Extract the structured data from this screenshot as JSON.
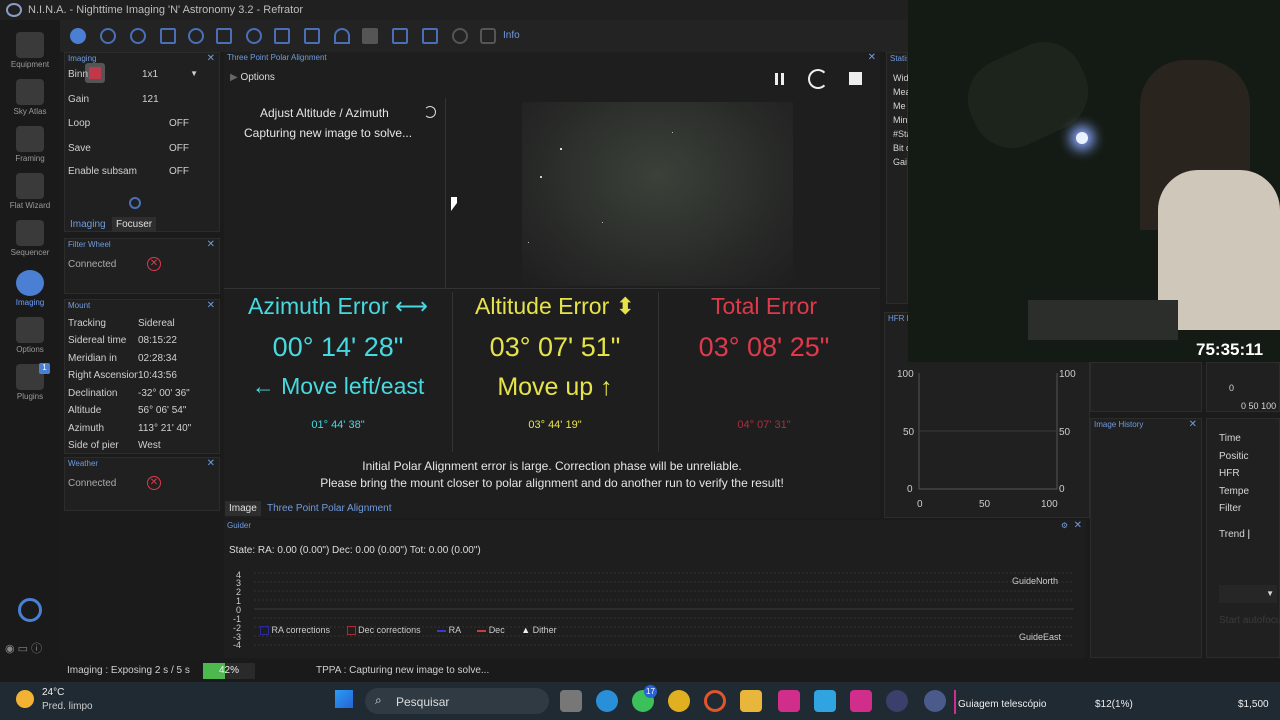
{
  "window": {
    "title": "N.I.N.A. - Nighttime Imaging 'N' Astronomy 3.2  -  Refrator"
  },
  "sidebar": {
    "items": [
      {
        "label": "Equipment",
        "icon": "camera-icon"
      },
      {
        "label": "Sky Atlas",
        "icon": "map-icon"
      },
      {
        "label": "Framing",
        "icon": "framing-icon"
      },
      {
        "label": "Flat Wizard",
        "icon": "flat-icon"
      },
      {
        "label": "Sequencer",
        "icon": "sequencer-icon"
      },
      {
        "label": "Imaging",
        "icon": "imaging-icon"
      },
      {
        "label": "Options",
        "icon": "gear-icon"
      },
      {
        "label": "Plugins",
        "icon": "puzzle-icon"
      }
    ],
    "plugins_badge": "1",
    "collapse": "< <"
  },
  "toolbar": {
    "info_label": "Info"
  },
  "imaging_panel": {
    "title": "Imaging",
    "rows": [
      {
        "label": "Binn",
        "value": "1x1"
      },
      {
        "label": "Gain",
        "value": "121"
      },
      {
        "label": "Loop",
        "value": "OFF"
      },
      {
        "label": "Save",
        "value": "OFF"
      },
      {
        "label": "Enable subsam",
        "value": "OFF"
      }
    ],
    "tabs": [
      "Imaging",
      "Focuser"
    ]
  },
  "filterwheel": {
    "title": "Filter Wheel",
    "connected": "Connected"
  },
  "mount": {
    "title": "Mount",
    "rows": [
      {
        "label": "Tracking",
        "value": "Sidereal"
      },
      {
        "label": "Sidereal time",
        "value": "08:15:22"
      },
      {
        "label": "Meridian in",
        "value": "02:28:34"
      },
      {
        "label": "Right Ascension",
        "value": "10:43:56"
      },
      {
        "label": "Declination",
        "value": "-32° 00' 36\""
      },
      {
        "label": "Altitude",
        "value": "56° 06' 54\""
      },
      {
        "label": "Azimuth",
        "value": "113° 21' 40\""
      },
      {
        "label": "Side of pier",
        "value": "West"
      }
    ]
  },
  "weather": {
    "title": "Weather",
    "connected": "Connected"
  },
  "tppa": {
    "title": "Three Point Polar Alignment",
    "options": "Options",
    "step": "Adjust Altitude / Azimuth",
    "status": "Capturing new image to solve...",
    "az_title": "Azimuth Error ⟷",
    "az_value": "00° 14' 28\"",
    "az_move": "← Move left/east",
    "az_sub": "01° 44' 38\"",
    "alt_title": "Altitude Error ⬍",
    "alt_value": "03° 07' 51\"",
    "alt_move": "Move up ↑",
    "alt_sub": "03° 44' 19\"",
    "tot_title": "Total Error",
    "tot_value": "03° 08' 25\"",
    "tot_sub": "04° 07' 31\"",
    "warning1": "Initial Polar Alignment error is large. Correction phase will be unreliable.",
    "warning2": "Please bring the mount closer to polar alignment and do another run to verify the result!",
    "tabs": [
      "Image",
      "Three Point Polar Alignment"
    ]
  },
  "statistics": {
    "title": "Statist",
    "rows": [
      "Wid",
      "Mea",
      "Me",
      "Min",
      "#Sta",
      "Bit d",
      "Gai"
    ]
  },
  "hfr": {
    "title": "HFR h",
    "yticks": [
      "100",
      "50",
      "0"
    ],
    "xticks": [
      "0",
      "50",
      "100"
    ],
    "bottom_labels": [
      "0",
      "50",
      "100"
    ]
  },
  "image_history": {
    "title": "Image History"
  },
  "right_info": {
    "rows": [
      "Time",
      "Positic",
      "HFR",
      "Tempe",
      "Filter",
      "Trend"
    ]
  },
  "right_misc": {
    "start_label": "Start autofocus"
  },
  "guider": {
    "title": "Guider",
    "state": "State:  RA: 0.00 (0.00\")  Dec: 0.00 (0.00\")  Tot: 0.00 (0.00\")",
    "yticks": [
      "4",
      "3",
      "2",
      "1",
      "0",
      "-1",
      "-2",
      "-3",
      "-4"
    ],
    "north": "GuideNorth",
    "east": "GuideEast",
    "legend": [
      "RA corrections",
      "Dec corrections",
      "RA",
      "Dec",
      "Dither"
    ]
  },
  "statusbar": {
    "imaging": "Imaging :   Exposing 2 s / 5 s",
    "progress": 0.42,
    "progress_label": "42%",
    "tppa": "TPPA :   Capturing new image to solve..."
  },
  "stream": {
    "timer": "75:35:11"
  },
  "taskbar": {
    "weather_temp": "24°C",
    "weather_desc": "Pred. limpo",
    "search": "Pesquisar",
    "badge": "17",
    "app_label": "Guiagem telescópio",
    "price1": "$12(1%)",
    "price2": "$1,500"
  }
}
